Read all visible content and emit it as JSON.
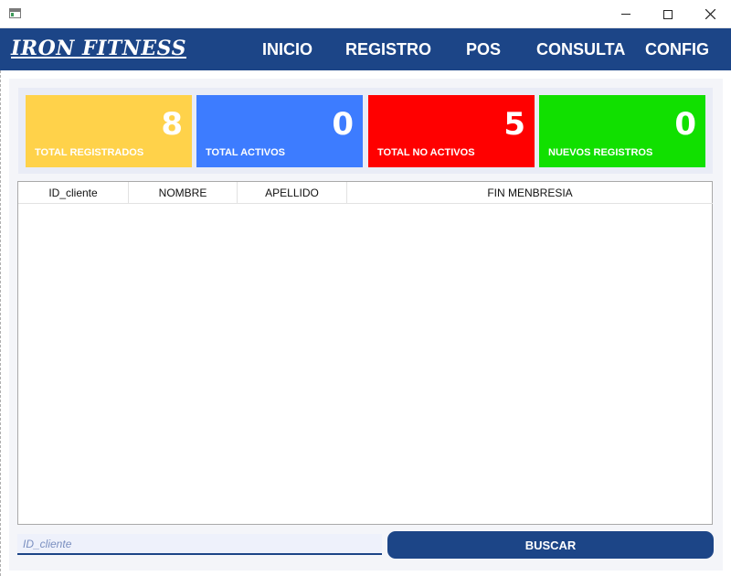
{
  "window": {
    "title": ""
  },
  "nav": {
    "brand": "IRON FITNESS",
    "items": [
      {
        "label": "INICIO"
      },
      {
        "label": "REGISTRO"
      },
      {
        "label": "POS"
      },
      {
        "label": "CONSULTA"
      },
      {
        "label": "CONFIG"
      }
    ]
  },
  "stats": [
    {
      "value": "8",
      "label": "TOTAL REGISTRADOS",
      "color": "#ffd24a"
    },
    {
      "value": "0",
      "label": "TOTAL ACTIVOS",
      "color": "#3d7cff"
    },
    {
      "value": "5",
      "label": "TOTAL NO ACTIVOS",
      "color": "#ff0000"
    },
    {
      "value": "0",
      "label": "NUEVOS REGISTROS",
      "color": "#11e000"
    }
  ],
  "table": {
    "columns": [
      "ID_cliente",
      "NOMBRE",
      "APELLIDO",
      "FIN MENBRESIA"
    ],
    "rows": []
  },
  "search": {
    "placeholder": "ID_cliente",
    "value": ""
  },
  "actions": {
    "buscar_label": "BUSCAR"
  },
  "colors": {
    "primary": "#1c4587",
    "panel": "#f4f5f9"
  }
}
